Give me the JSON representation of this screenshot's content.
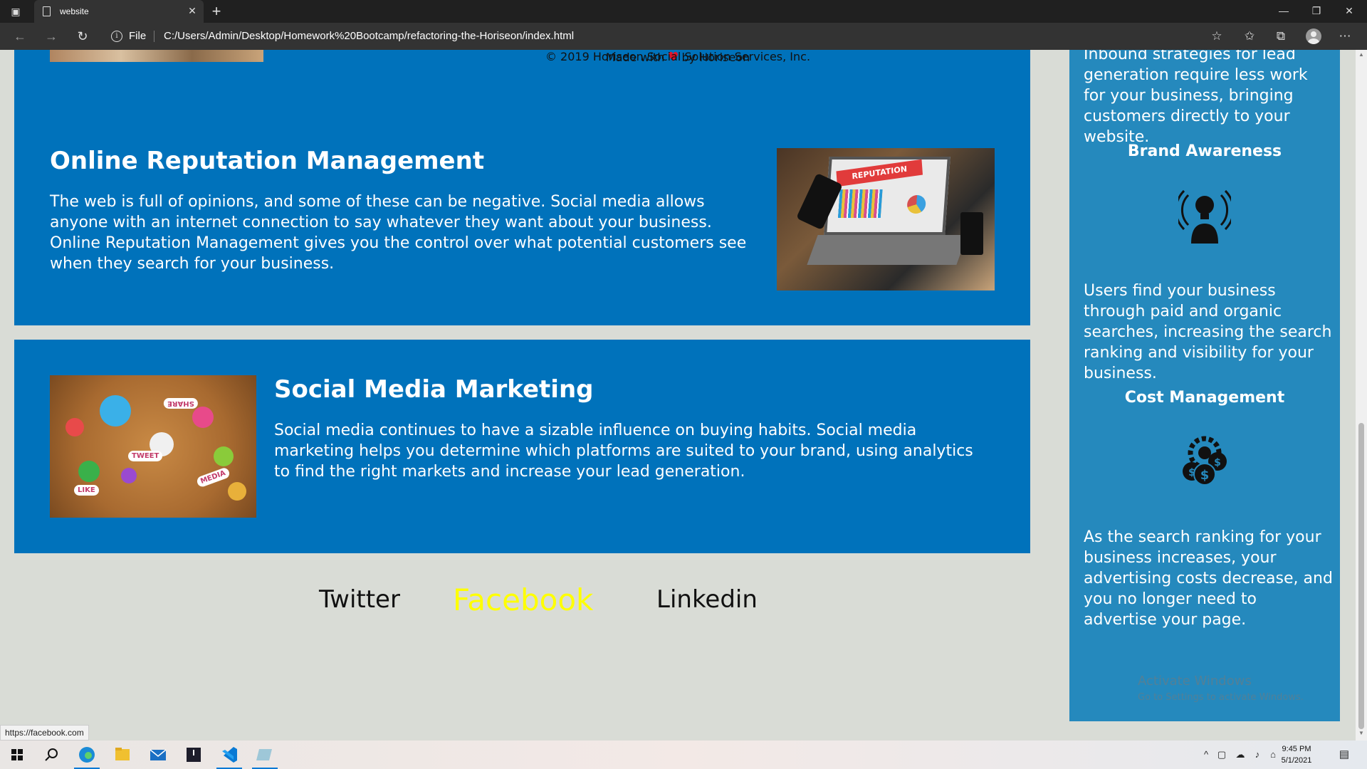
{
  "browser": {
    "tab_title": "website",
    "address_scheme": "File",
    "url": "C:/Users/Admin/Desktop/Homework%20Bootcamp/refactoring-the-Horiseon/index.html"
  },
  "sections": {
    "online_reputation": {
      "title": "Online Reputation Management",
      "body": "The web is full of opinions, and some of these can be negative. Social media allows anyone with an internet connection to say whatever they want about your business. Online Reputation Management gives you the control over what potential customers see when they search for your business.",
      "image_text": "REPUTATION"
    },
    "social_media": {
      "title": "Social Media Marketing",
      "body": "Social media continues to have a sizable influence on buying habits. Social media marketing helps you determine which platforms are suited to your brand, using analytics to find the right markets and increase your lead generation.",
      "image_words": [
        "SHARE",
        "TWEET",
        "LIKE",
        "MEDIA"
      ]
    }
  },
  "social_links": [
    "Twitter",
    "Facebook",
    "Linkedin"
  ],
  "aside": {
    "lead_generation_tail": "Inbound strategies for lead generation require less work for your business, bringing customers directly to your website.",
    "brand_awareness": {
      "title": "Brand Awareness",
      "body": "Users find your business through paid and organic searches, increasing the search ranking and visibility for your business."
    },
    "cost_management": {
      "title": "Cost Management",
      "body": "As the search ranking for your business increases, your advertising costs decrease, and you no longer need to advertise your page."
    }
  },
  "footer": {
    "made_prefix": "Made with",
    "made_suffix": "by Horiseon",
    "copyright": "© 2019 Horiseon Social Solution Services, Inc."
  },
  "watermark": {
    "title": "Activate Windows",
    "subtitle": "Go to Settings to activate Windows."
  },
  "status_url": "https://facebook.com",
  "clock": {
    "time": "9:45 PM",
    "date": "5/1/2021"
  },
  "colors": {
    "card": "#0072bb",
    "aside": "#2589bd",
    "page_bg": "#d9dcd6",
    "link_hover": "#ffff00",
    "heart": "#e0142a"
  }
}
